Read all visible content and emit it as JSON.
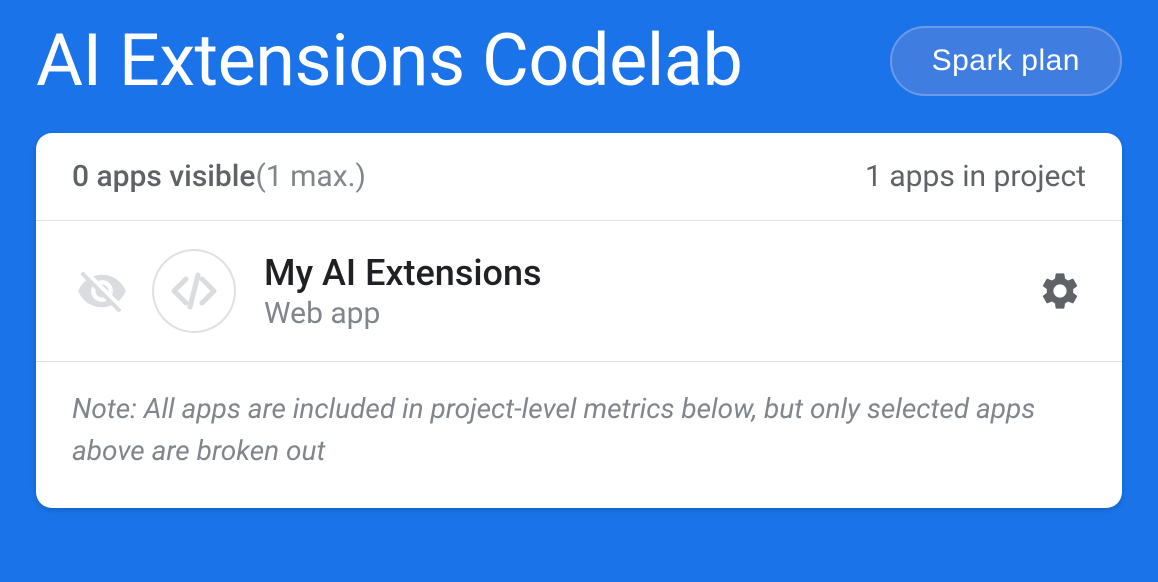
{
  "header": {
    "title": "AI Extensions Codelab",
    "plan_label": "Spark plan"
  },
  "card": {
    "visible_count_label": "0 apps visible",
    "visible_max_label": "(1 max.)",
    "project_count_label": "1 apps in project"
  },
  "app": {
    "name": "My AI Extensions",
    "type": "Web app"
  },
  "note": {
    "text": "Note: All apps are included in project-level metrics below, but only selected apps above are broken out"
  },
  "colors": {
    "primary": "#1a73e8",
    "badge_bg": "#3f7de0",
    "badge_border": "#6b9ae8",
    "text_dark": "#202124",
    "text_medium": "#5f6368",
    "text_light": "#80868b",
    "icon_light": "#dadce0",
    "icon_dark": "#5f6368"
  }
}
